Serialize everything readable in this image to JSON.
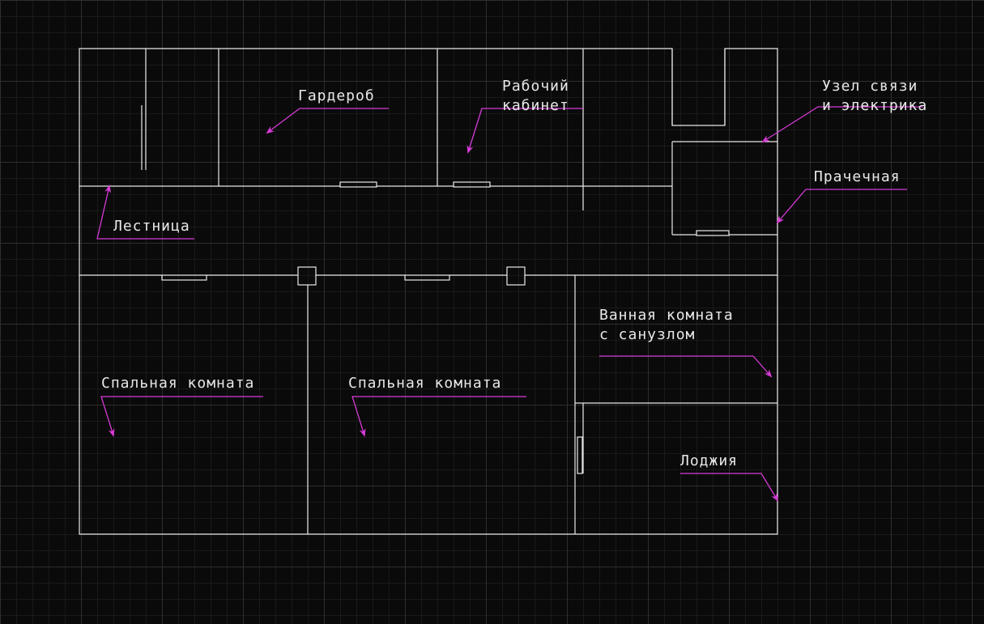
{
  "colors": {
    "background": "#0a0a0a",
    "grid_minor": "#1a1a1a",
    "grid_major": "#2e2e2e",
    "wall": "#e8e8e8",
    "leader": "#d63ad6",
    "text": "#e8e8e8"
  },
  "rooms": {
    "wardrobe": {
      "label": "Гардероб"
    },
    "study": {
      "label_line1": "Рабочий",
      "label_line2": "кабинет"
    },
    "comms": {
      "label_line1": "Узел связи",
      "label_line2": "и электрика"
    },
    "laundry": {
      "label": "Прачечная"
    },
    "stairs": {
      "label": "Лестница"
    },
    "bath": {
      "label_line1": "Ванная комната",
      "label_line2": "с санузлом"
    },
    "bedroom1": {
      "label": "Спальная комната"
    },
    "bedroom2": {
      "label": "Спальная комната"
    },
    "loggia": {
      "label": "Лоджия"
    }
  }
}
